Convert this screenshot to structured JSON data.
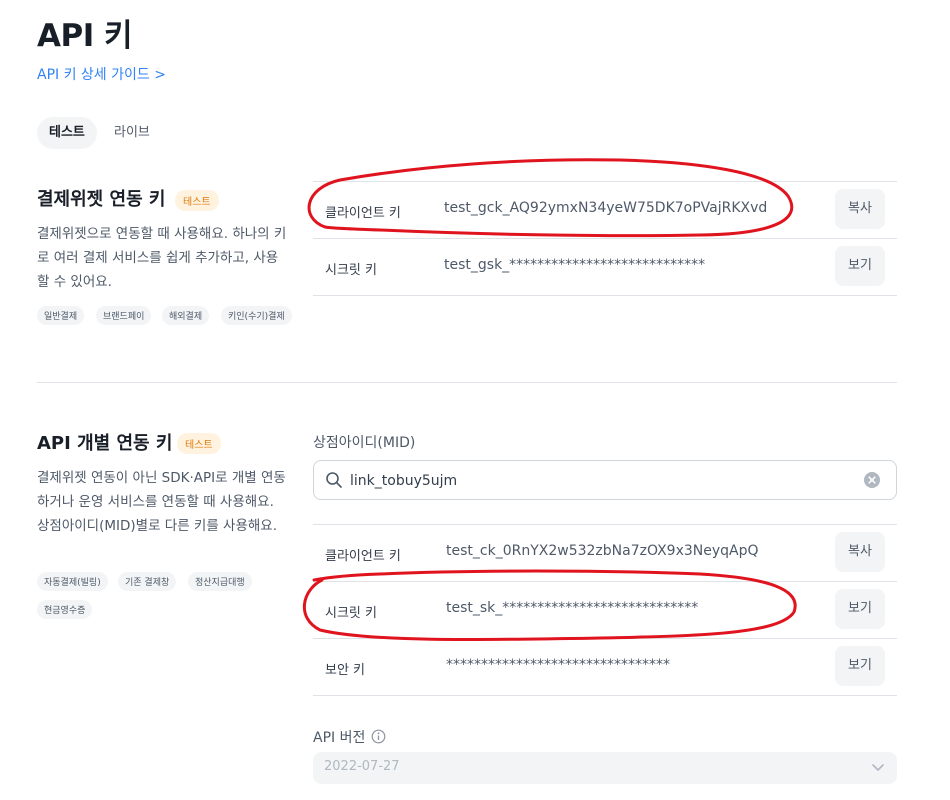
{
  "page": {
    "title": "API 키",
    "guide_link": "API 키 상세 가이드 >"
  },
  "tabs": [
    {
      "label": "테스트",
      "active": true
    },
    {
      "label": "라이브",
      "active": false
    }
  ],
  "widget_section": {
    "title": "결제위젯 연동 키",
    "badge": "테스트",
    "description": "결제위젯으로 연동할 때 사용해요. 하나의 키로 여러 결제 서비스를 쉽게 추가하고, 사용할 수 있어요.",
    "chips": [
      "일반결제",
      "브랜드페이",
      "해외결제",
      "키인(수기)결제"
    ],
    "keys": [
      {
        "label": "클라이언트 키",
        "value": "test_gck_AQ92ymxN34yeW75DK7oPVajRKXvd",
        "button": "복사"
      },
      {
        "label": "시크릿 키",
        "value": "test_gsk_****************************",
        "button": "보기"
      }
    ]
  },
  "api_section": {
    "title": "API 개별 연동 키",
    "badge": "테스트",
    "description": "결제위젯 연동이 아닌 SDK·API로 개별 연동하거나 운영 서비스를 연동할 때 사용해요. 상점아이디(MID)별로 다른 키를 사용해요.",
    "chips": [
      "자동결제(빌링)",
      "기존 결제창",
      "정산지급대행",
      "현금영수증"
    ],
    "mid_label": "상점아이디(MID)",
    "mid_value": "link_tobuy5ujm",
    "keys": [
      {
        "label": "클라이언트 키",
        "value": "test_ck_0RnYX2w532zbNa7zOX9x3NeyqApQ",
        "button": "복사"
      },
      {
        "label": "시크릿 키",
        "value": "test_sk_****************************",
        "button": "보기"
      },
      {
        "label": "보안 키",
        "value": "********************************",
        "button": "보기"
      }
    ],
    "api_version_label": "API 버전",
    "api_version_value": "2022-07-27"
  },
  "colors": {
    "accent": "#3182f6",
    "annotation": "#e0141e",
    "badge_text": "#e07a0a"
  },
  "icons": [
    "search-icon",
    "clear-icon",
    "info-icon",
    "chevron-down-icon",
    "chevron-right-icon"
  ]
}
